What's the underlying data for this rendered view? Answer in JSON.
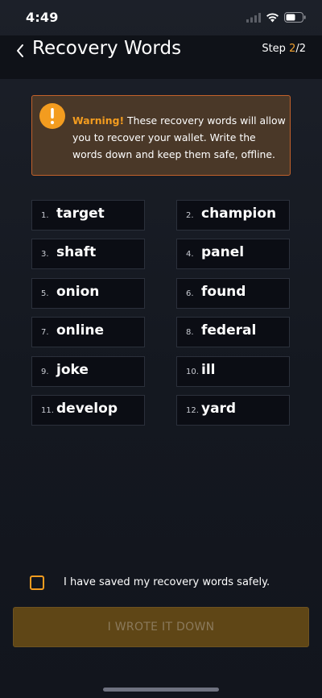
{
  "status_bar": {
    "time": "4:49",
    "icons": [
      "signal-icon",
      "wifi-icon",
      "battery-icon"
    ]
  },
  "header": {
    "title": "Recovery Words",
    "step_prefix": "Step ",
    "step_current": "2",
    "step_total": "/2"
  },
  "warning": {
    "label": "Warning!",
    "message": " These recovery words will allow you to recover your wallet. Write the words down and keep them safe, offline.",
    "icon": "exclamation-icon"
  },
  "words": [
    {
      "num": "1.",
      "word": "target"
    },
    {
      "num": "2.",
      "word": "champion"
    },
    {
      "num": "3.",
      "word": "shaft"
    },
    {
      "num": "4.",
      "word": "panel"
    },
    {
      "num": "5.",
      "word": "onion"
    },
    {
      "num": "6.",
      "word": "found"
    },
    {
      "num": "7.",
      "word": "online"
    },
    {
      "num": "8.",
      "word": "federal"
    },
    {
      "num": "9.",
      "word": "joke"
    },
    {
      "num": "10.",
      "word": "ill"
    },
    {
      "num": "11.",
      "word": "develop"
    },
    {
      "num": "12.",
      "word": "yard"
    }
  ],
  "confirm": {
    "label": "I have saved my recovery words safely.",
    "checked": false
  },
  "primary_button": {
    "label": "I WROTE IT DOWN",
    "enabled": false
  },
  "colors": {
    "accent": "#f39c1f",
    "warning_bg": "#4a3828",
    "warning_border": "#c2612a",
    "button_disabled_bg": "#5f4616"
  }
}
